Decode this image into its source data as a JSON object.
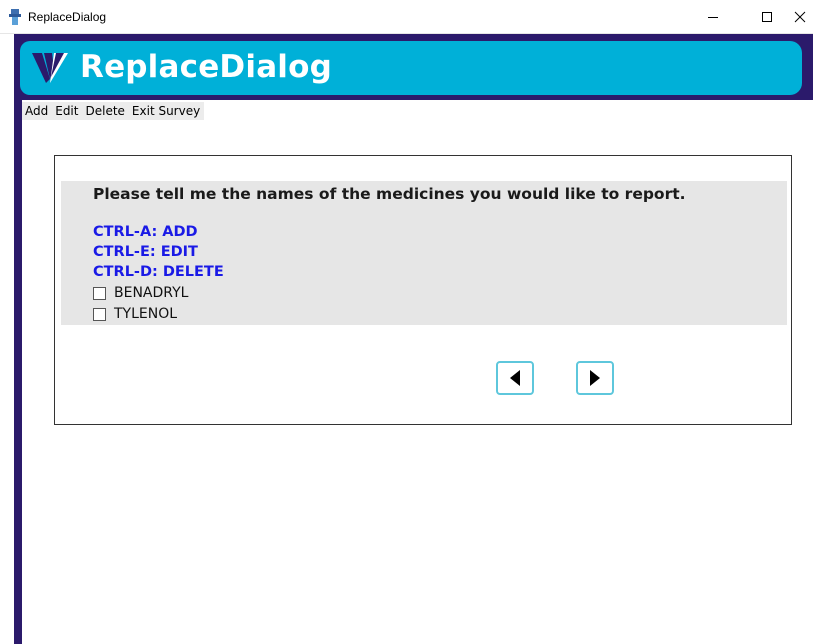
{
  "window": {
    "title": "ReplaceDialog"
  },
  "banner": {
    "title": "ReplaceDialog",
    "color": "#00b0d8",
    "frame_color": "#2b1a6b"
  },
  "menu": {
    "items": [
      "Add",
      "Edit",
      "Delete",
      "Exit Survey"
    ]
  },
  "question": {
    "text": "Please tell me the names of the medicines you would like to report.",
    "shortcuts": {
      "add": "CTRL-A: ADD",
      "edit": "CTRL-E: EDIT",
      "delete": "CTRL-D: DELETE"
    },
    "options": [
      {
        "label": "BENADRYL",
        "checked": false
      },
      {
        "label": "TYLENOL",
        "checked": false
      }
    ]
  },
  "navigation": {
    "prev_icon": "triangle-left-icon",
    "next_icon": "triangle-right-icon"
  }
}
